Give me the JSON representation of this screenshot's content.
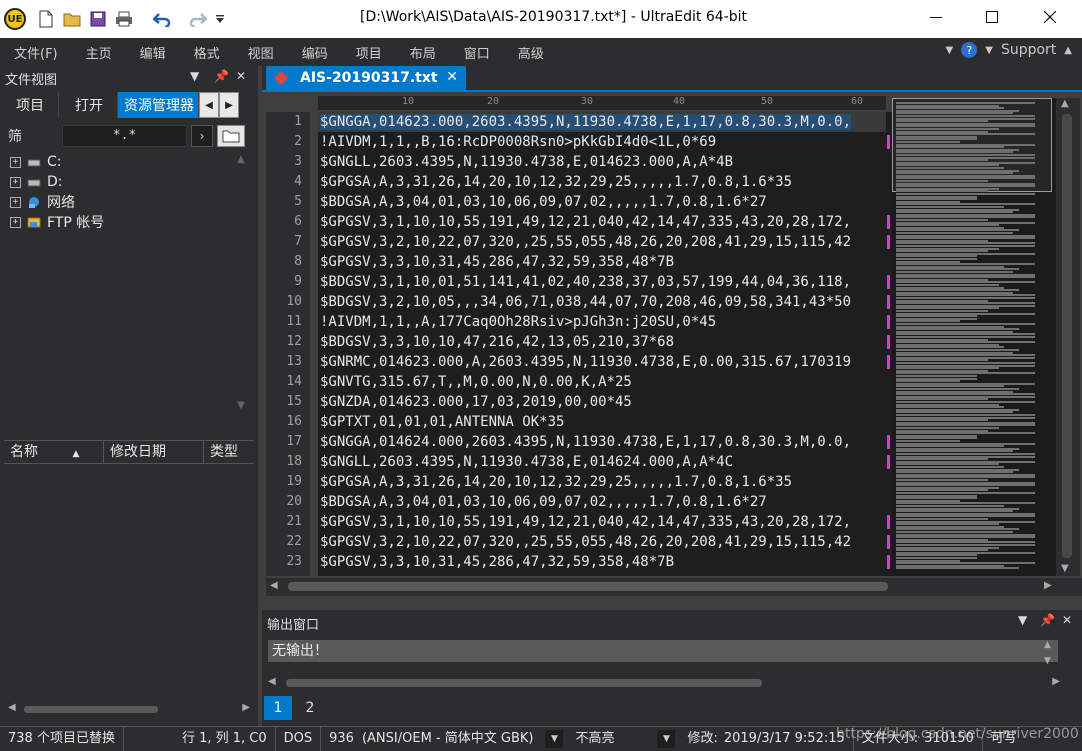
{
  "window": {
    "title": "[D:\\Work\\AIS\\Data\\AIS-20190317.txt*] - UltraEdit 64-bit",
    "app_logo_text": "UE"
  },
  "menu": [
    "文件(F)",
    "主页",
    "编辑",
    "格式",
    "视图",
    "编码",
    "项目",
    "布局",
    "窗口",
    "高级"
  ],
  "menu_right": {
    "support": "Support"
  },
  "file_view": {
    "title": "文件视图",
    "tabs": [
      "项目",
      "打开",
      "资源管理器"
    ],
    "filter_label": "筛",
    "filter_value": "*.*",
    "tree": [
      "C:",
      "D:",
      "网络",
      "FTP 帐号"
    ],
    "columns": [
      "名称",
      "修改日期",
      "类型"
    ]
  },
  "editor": {
    "tab_label": "AIS-20190317.txt",
    "ruler_marks": [
      "10",
      "20",
      "30",
      "40",
      "50",
      "60"
    ],
    "lines": [
      "$GNGGA,014623.000,2603.4395,N,11930.4738,E,1,17,0.8,30.3,M,0.0,",
      "!AIVDM,1,1,,B,16:RcDP0008Rsn0>pKkGbI4d0<1L,0*69",
      "$GNGLL,2603.4395,N,11930.4738,E,014623.000,A,A*4B",
      "$GPGSA,A,3,31,26,14,20,10,12,32,29,25,,,,,1.7,0.8,1.6*35",
      "$BDGSA,A,3,04,01,03,10,06,09,07,02,,,,,1.7,0.8,1.6*27",
      "$GPGSV,3,1,10,10,55,191,49,12,21,040,42,14,47,335,43,20,28,172,",
      "$GPGSV,3,2,10,22,07,320,,25,55,055,48,26,20,208,41,29,15,115,42",
      "$GPGSV,3,3,10,31,45,286,47,32,59,358,48*7B",
      "$BDGSV,3,1,10,01,51,141,41,02,40,238,37,03,57,199,44,04,36,118,",
      "$BDGSV,3,2,10,05,,,34,06,71,038,44,07,70,208,46,09,58,341,43*50",
      "!AIVDM,1,1,,A,177Caq0Oh28Rsiv>pJGh3n:j20SU,0*45",
      "$BDGSV,3,3,10,10,47,216,42,13,05,210,37*68",
      "$GNRMC,014623.000,A,2603.4395,N,11930.4738,E,0.00,315.67,170319",
      "$GNVTG,315.67,T,,M,0.00,N,0.00,K,A*25",
      "$GNZDA,014623.000,17,03,2019,00,00*45",
      "$GPTXT,01,01,01,ANTENNA OK*35",
      "$GNGGA,014624.000,2603.4395,N,11930.4738,E,1,17,0.8,30.3,M,0.0,",
      "$GNGLL,2603.4395,N,11930.4738,E,014624.000,A,A*4C",
      "$GPGSA,A,3,31,26,14,20,10,12,32,29,25,,,,,1.7,0.8,1.6*35",
      "$BDGSA,A,3,04,01,03,10,06,09,07,02,,,,,1.7,0.8,1.6*27",
      "$GPGSV,3,1,10,10,55,191,49,12,21,040,42,14,47,335,43,20,28,172,",
      "$GPGSV,3,2,10,22,07,320,,25,55,055,48,26,20,208,41,29,15,115,42",
      "$GPGSV,3,3,10,31,45,286,47,32,59,358,48*7B"
    ]
  },
  "output": {
    "title": "输出窗口",
    "text": "无输出！",
    "tabs": [
      "1",
      "2"
    ]
  },
  "status": {
    "replaced": "738 个项目已替换",
    "position": "行 1, 列 1, C0",
    "line_ending": "DOS",
    "codepage": "936",
    "encoding": "(ANSI/OEM - 简体中文 GBK)",
    "highlight": "不高亮",
    "modified_label": "修改:",
    "modified_value": "2019/3/17 9:52:15",
    "size_label": "文件大小:",
    "size_value": "310150",
    "mode": "可写"
  },
  "watermark": "https://blog.csdn.net/sunriver2000",
  "colors": {
    "accent": "#007acc",
    "panel": "#2d2d30",
    "editor_bg": "#1e1e1e"
  }
}
